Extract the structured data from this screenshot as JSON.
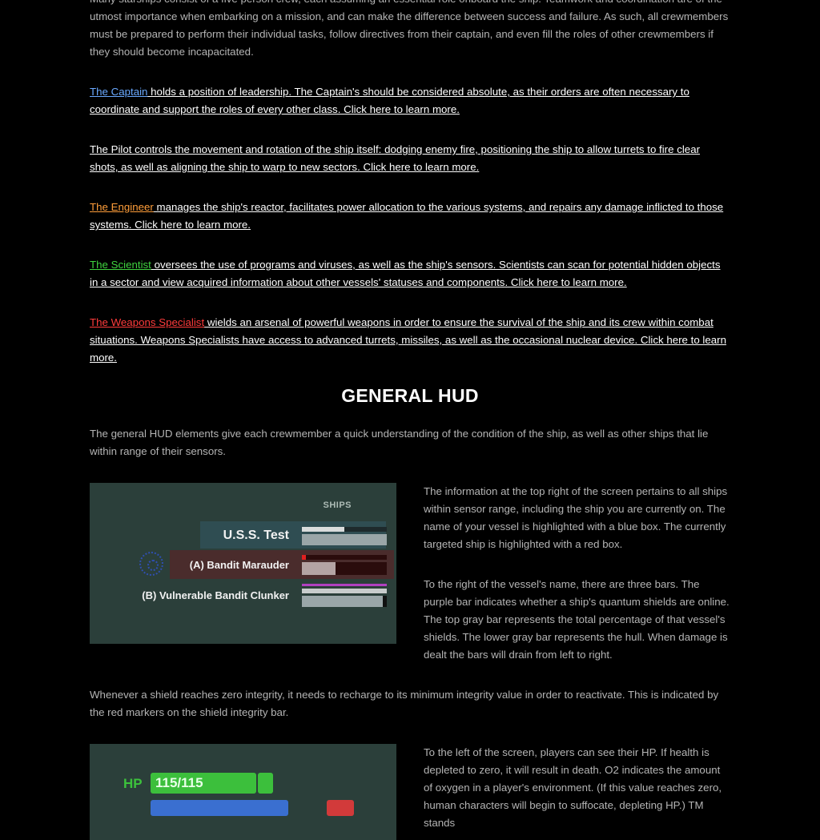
{
  "intro": "Many starships consist of a five person crew, each assuming an essential role onboard the ship. Teamwork and coordination are of the utmost importance when embarking on a mission, and can make the difference between success and failure. As such, all crewmembers must be prepared to perform their individual tasks, follow directives from their captain, and even fill the roles of other crewmembers if they should become incapacitated.",
  "classes": {
    "captain": {
      "link": "The Captain",
      "text": " holds a position of leadership. The Captain's should be considered absolute, as their orders are often necessary to coordinate and support the roles of every other class. Click here to learn more."
    },
    "pilot": {
      "text": "The Pilot controls the movement and rotation of the ship itself: dodging enemy fire, positioning the ship to allow turrets to fire clear shots, as well as aligning the ship to warp to new sectors. Click here to learn more."
    },
    "engineer": {
      "link": "The Engineer",
      "text": " manages the ship's reactor, facilitates power allocation to the various systems, and repairs any damage inflicted to those systems. Click here to learn more."
    },
    "scientist": {
      "link": "The Scientist",
      "text": " oversees the use of programs and viruses, as well as the ship's sensors. Scientists can scan for potential hidden objects in a sector and view acquired information about other vessels' statuses and components. Click here to learn more."
    },
    "weapons": {
      "link": "The Weapons Specialist",
      "text": " wields an arsenal of powerful weapons in order to ensure the survival of the ship and its crew within combat situations. Weapons Specialists have access to advanced turrets, missiles, as well as the occasional nuclear device. Click here to learn more."
    }
  },
  "hud": {
    "heading": "GENERAL HUD",
    "intro": "The general HUD elements give each crewmember a quick understanding of the condition of the ship, as well as other ships that lie within range of their sensors.",
    "ships_panel": {
      "header": "SHIPS",
      "ships": [
        {
          "name": "U.S.S. Test",
          "shield": 0.5,
          "hull": 1.0
        },
        {
          "name": "(A) Bandit Marauder",
          "shield": 0.05,
          "hull": 0.4
        },
        {
          "name": "(B) Vulnerable Bandit Clunker",
          "shield": 1.0,
          "hull": 0.95
        }
      ]
    },
    "ships_desc_1": "The information at the top right of the screen pertains to all ships within sensor range, including the ship you are currently on. The name of your vessel is highlighted with a blue box. The currently targeted ship is highlighted with a red box.",
    "ships_desc_2": "To the right of the vessel's name, there are three bars. The purple bar indicates whether a ship's quantum shields are online. The top gray bar represents the total percentage of that vessel's shields. The lower gray bar represents the hull. When damage is dealt the bars will drain from left to right.",
    "shield_note": "Whenever a shield reaches zero integrity, it needs to recharge to its minimum integrity value in order to reactivate. This is indicated by the red markers on the shield integrity bar.",
    "player_panel": {
      "hp_label": "HP",
      "hp_value": "115/115"
    },
    "player_desc": "To the left of the screen, players can see their HP. If health is depleted to zero, it will result in death. O2 indicates the amount of oxygen in a player's environment. (If this value reaches zero, human characters will begin to suffocate, depleting HP.) TM stands"
  }
}
